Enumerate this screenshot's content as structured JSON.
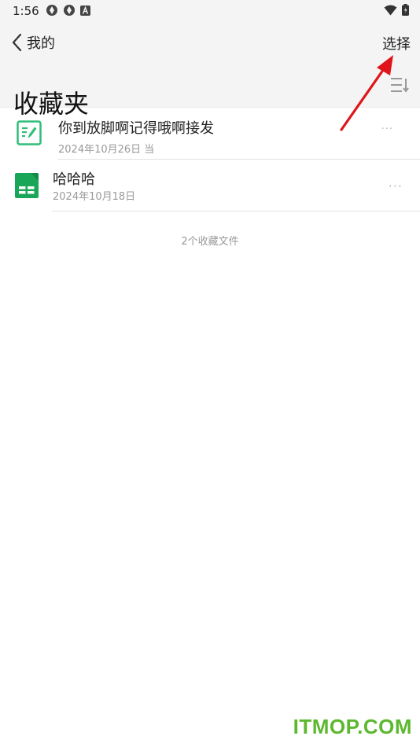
{
  "status_bar": {
    "time": "1:56",
    "icons": [
      "aperture-icon",
      "aperture-icon",
      "font-a-icon",
      "wifi-icon",
      "battery-icon"
    ]
  },
  "header": {
    "back_label": "我的",
    "select_label": "选择",
    "title": "收藏夹"
  },
  "files": [
    {
      "name": "你到放脚啊记得哦啊接发",
      "date": "2024年10月26日 当",
      "icon": "note-edit-icon"
    },
    {
      "name": "哈哈哈",
      "date": "2024年10月18日",
      "icon": "spreadsheet-icon"
    }
  ],
  "footer": {
    "count_text": "2个收藏文件"
  },
  "watermark": "ITMOP.COM",
  "colors": {
    "note_icon_green": "#2fbf7a",
    "sheet_icon_green": "#1aa658",
    "arrow_red": "#e0151b",
    "watermark_green": "#5cb82e"
  }
}
